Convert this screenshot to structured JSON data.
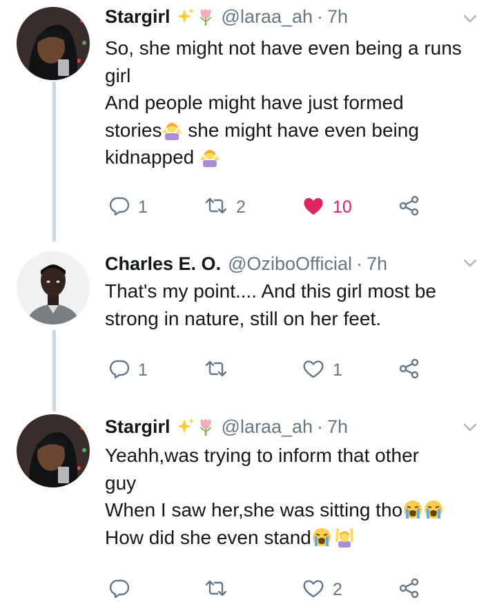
{
  "tweets": [
    {
      "name": "Stargirl",
      "handle": "@laraa_ah",
      "separator": "·",
      "time": "7h",
      "lines": [
        "So, she might not have even being a runs",
        "girl",
        "And people might have just formed",
        "stories",
        " she might have even being",
        "kidnapped "
      ],
      "replies": "1",
      "retweets": "2",
      "likes": "10",
      "liked": true
    },
    {
      "name": "Charles E. O.",
      "handle": "@OziboOfficial",
      "separator": "·",
      "time": "7h",
      "lines": [
        "That's my point.... And this girl most be",
        "strong in nature, still on her feet."
      ],
      "replies": "1",
      "retweets": "",
      "likes": "1",
      "liked": false
    },
    {
      "name": "Stargirl",
      "handle": "@laraa_ah",
      "separator": "·",
      "time": "7h",
      "lines": [
        "Yeahh,was trying to inform that other",
        "guy",
        "When I saw her,she was sitting tho",
        "How did she even stand"
      ],
      "replies": "",
      "retweets": "",
      "likes": "2",
      "liked": false
    }
  ],
  "icons": {
    "reply": "reply-icon",
    "retweet": "retweet-icon",
    "like": "heart-icon",
    "share": "share-icon",
    "caret": "chevron-down-icon",
    "name_emoji": [
      "sparkles-icon",
      "tulip-icon"
    ],
    "shrug": "person-shrugging-emoji",
    "crying": "loudly-crying-face-emoji",
    "raised_hands": "person-raising-hands-emoji"
  },
  "colors": {
    "text": "#14171a",
    "secondary": "#657786",
    "like_active": "#e0245e",
    "thread_line": "#ccd6dd"
  }
}
